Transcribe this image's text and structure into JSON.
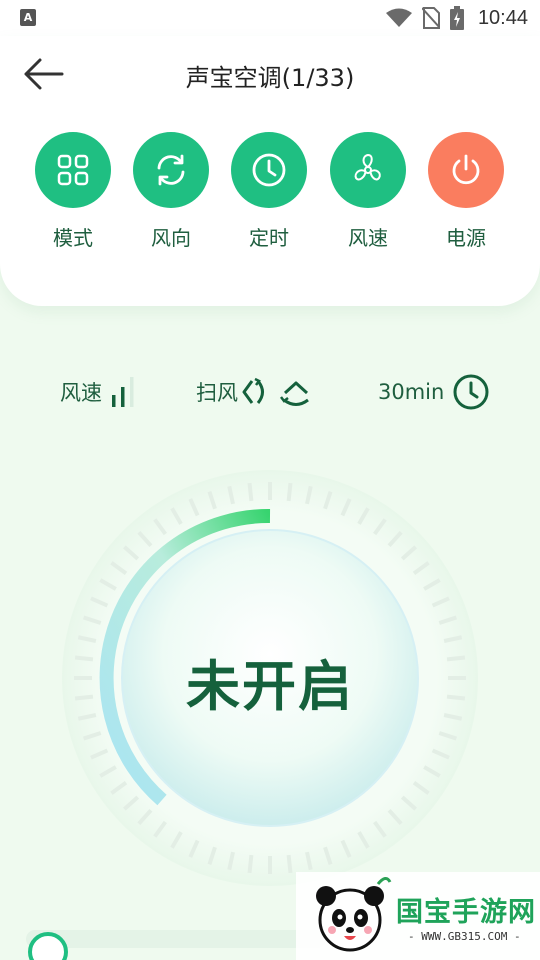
{
  "status_bar": {
    "badge": "A",
    "time": "10:44",
    "icons": [
      "wifi-icon",
      "no-sim-icon",
      "battery-charging-icon"
    ]
  },
  "header": {
    "back_icon": "arrow-left-icon",
    "title": "声宝空调(1/33)"
  },
  "controls": [
    {
      "label": "模式",
      "icon": "grid-icon"
    },
    {
      "label": "风向",
      "icon": "refresh-icon"
    },
    {
      "label": "定时",
      "icon": "clock-icon"
    },
    {
      "label": "风速",
      "icon": "fan-icon"
    },
    {
      "label": "电源",
      "icon": "power-icon"
    }
  ],
  "status_row": {
    "fan_speed_label": "风速",
    "swing_label": "扫风",
    "timer_value": "30min"
  },
  "dial": {
    "state_text": "未开启"
  },
  "slider": {
    "value": 0
  },
  "watermark": {
    "brand": "国宝手游网",
    "url": "- WWW.GB315.COM -"
  },
  "colors": {
    "accent": "#1fbf82",
    "power": "#fa7d5f",
    "text_dark_green": "#1f5e3f",
    "background": "#effaef"
  }
}
